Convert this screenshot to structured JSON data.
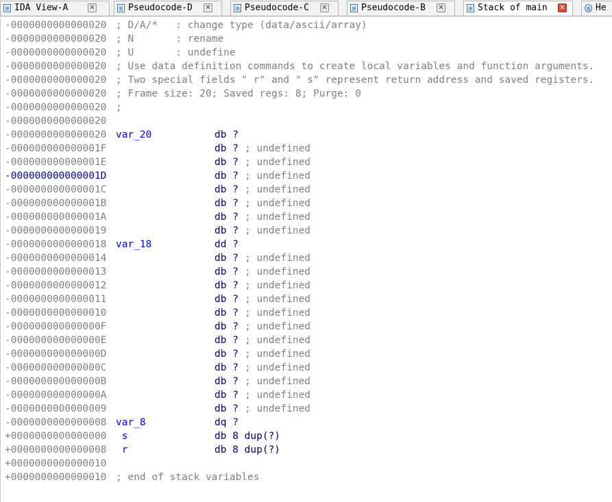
{
  "tabs": [
    {
      "label": "IDA View-A",
      "close": "✕",
      "active": false
    },
    {
      "label": "Pseudocode-D",
      "close": "✕",
      "active": false
    },
    {
      "label": "Pseudocode-C",
      "close": "✕",
      "active": false
    },
    {
      "label": "Pseudocode-B",
      "close": "✕",
      "active": false
    },
    {
      "label": "Stack of main",
      "close": "✕",
      "active": true
    },
    {
      "label": "He",
      "close": "",
      "active": false
    }
  ],
  "lines": [
    {
      "addr": "-0000000000000020",
      "name": "",
      "kw": "",
      "cmt": "; D/A/*   : change type (data/ascii/array)"
    },
    {
      "addr": "-0000000000000020",
      "name": "",
      "kw": "",
      "cmt": "; N       : rename"
    },
    {
      "addr": "-0000000000000020",
      "name": "",
      "kw": "",
      "cmt": "; U       : undefine"
    },
    {
      "addr": "-0000000000000020",
      "name": "",
      "kw": "",
      "cmt": "; Use data definition commands to create local variables and function arguments."
    },
    {
      "addr": "-0000000000000020",
      "name": "",
      "kw": "",
      "cmt": "; Two special fields \" r\" and \" s\" represent return address and saved registers."
    },
    {
      "addr": "-0000000000000020",
      "name": "",
      "kw": "",
      "cmt": "; Frame size: 20; Saved regs: 8; Purge: 0"
    },
    {
      "addr": "-0000000000000020",
      "name": "",
      "kw": "",
      "cmt": ";"
    },
    {
      "addr": "-0000000000000020",
      "name": "",
      "kw": "",
      "cmt": ""
    },
    {
      "addr": "-0000000000000020",
      "name": "var_20",
      "kw": "db ?",
      "cmt": ""
    },
    {
      "addr": "-000000000000001F",
      "name": "",
      "kw": "db ?",
      "cmt": "; undefined"
    },
    {
      "addr": "-000000000000001E",
      "name": "",
      "kw": "db ?",
      "cmt": "; undefined"
    },
    {
      "addr": "-000000000000001D",
      "name": "",
      "kw": "db ?",
      "cmt": "; undefined",
      "selected": true
    },
    {
      "addr": "-000000000000001C",
      "name": "",
      "kw": "db ?",
      "cmt": "; undefined"
    },
    {
      "addr": "-000000000000001B",
      "name": "",
      "kw": "db ?",
      "cmt": "; undefined"
    },
    {
      "addr": "-000000000000001A",
      "name": "",
      "kw": "db ?",
      "cmt": "; undefined"
    },
    {
      "addr": "-0000000000000019",
      "name": "",
      "kw": "db ?",
      "cmt": "; undefined"
    },
    {
      "addr": "-0000000000000018",
      "name": "var_18",
      "kw": "dd ?",
      "cmt": ""
    },
    {
      "addr": "-0000000000000014",
      "name": "",
      "kw": "db ?",
      "cmt": "; undefined"
    },
    {
      "addr": "-0000000000000013",
      "name": "",
      "kw": "db ?",
      "cmt": "; undefined"
    },
    {
      "addr": "-0000000000000012",
      "name": "",
      "kw": "db ?",
      "cmt": "; undefined"
    },
    {
      "addr": "-0000000000000011",
      "name": "",
      "kw": "db ?",
      "cmt": "; undefined"
    },
    {
      "addr": "-0000000000000010",
      "name": "",
      "kw": "db ?",
      "cmt": "; undefined"
    },
    {
      "addr": "-000000000000000F",
      "name": "",
      "kw": "db ?",
      "cmt": "; undefined"
    },
    {
      "addr": "-000000000000000E",
      "name": "",
      "kw": "db ?",
      "cmt": "; undefined"
    },
    {
      "addr": "-000000000000000D",
      "name": "",
      "kw": "db ?",
      "cmt": "; undefined"
    },
    {
      "addr": "-000000000000000C",
      "name": "",
      "kw": "db ?",
      "cmt": "; undefined"
    },
    {
      "addr": "-000000000000000B",
      "name": "",
      "kw": "db ?",
      "cmt": "; undefined"
    },
    {
      "addr": "-000000000000000A",
      "name": "",
      "kw": "db ?",
      "cmt": "; undefined"
    },
    {
      "addr": "-0000000000000009",
      "name": "",
      "kw": "db ?",
      "cmt": "; undefined"
    },
    {
      "addr": "-0000000000000008",
      "name": "var_8",
      "kw": "dq ?",
      "cmt": ""
    },
    {
      "addr": "+0000000000000000",
      "name": " s",
      "kw": "db 8 dup(?)",
      "cmt": ""
    },
    {
      "addr": "+0000000000000008",
      "name": " r",
      "kw": "db 8 dup(?)",
      "cmt": ""
    },
    {
      "addr": "+0000000000000010",
      "name": "",
      "kw": "",
      "cmt": ""
    },
    {
      "addr": "+0000000000000010",
      "name": "",
      "kw": "",
      "cmt": "; end of stack variables"
    }
  ],
  "colors": {
    "address": "#808080",
    "selected_address": "#0000aa",
    "name": "#0000ff",
    "keyword": "#00007f",
    "comment": "#808080"
  }
}
